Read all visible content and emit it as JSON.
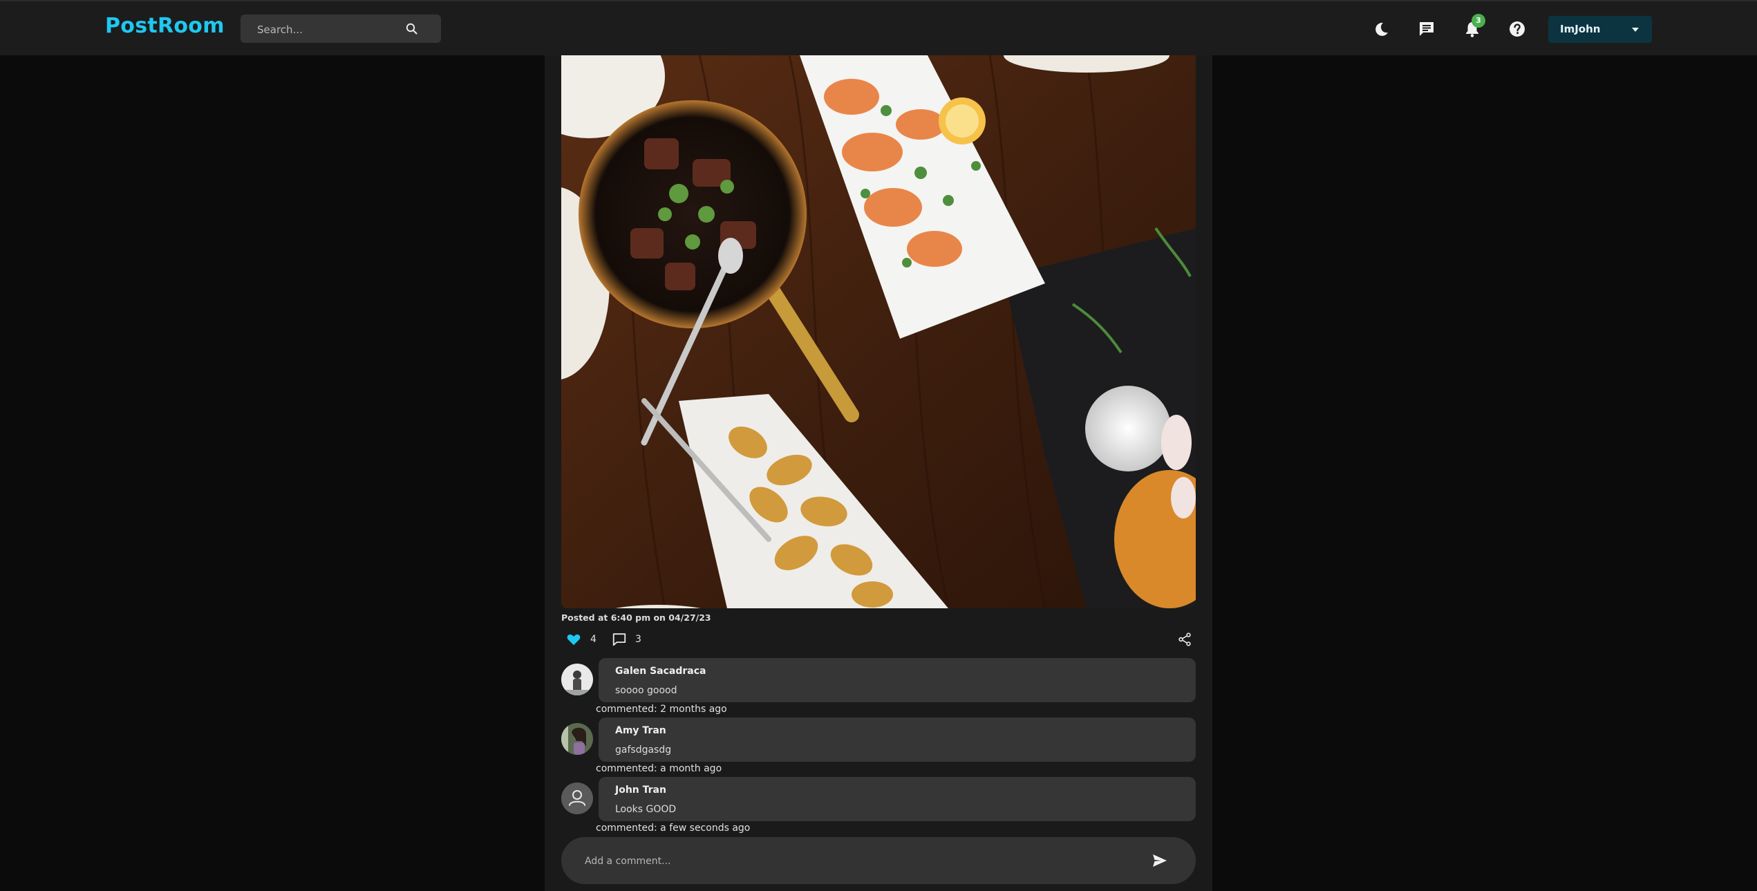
{
  "app": {
    "logo": "PostRoom"
  },
  "search": {
    "placeholder": "Search..."
  },
  "header": {
    "icons": [
      "moon-icon",
      "chat-icon",
      "bell-icon",
      "help-icon"
    ],
    "notification_count": "3",
    "user_name": "ImJohn"
  },
  "post": {
    "posted_text": "Posted at 6:40 pm on 04/27/23",
    "likes": "4",
    "comments_count": "3",
    "comments": [
      {
        "author": "Galen Sacadraca",
        "text": "soooo goood",
        "time": "commented: 2 months ago"
      },
      {
        "author": "Amy Tran",
        "text": "gafsdgasdg",
        "time": "commented: a month ago"
      },
      {
        "author": "John Tran",
        "text": "Looks GOOD",
        "time": "commented: a few seconds ago"
      }
    ],
    "add_comment_placeholder": "Add a comment..."
  },
  "colors": {
    "accent": "#1ec8f0",
    "navbar": "#1c1c1c",
    "background": "#0b0b0b",
    "user_button": "#0b3440",
    "badge": "#4caf50"
  }
}
